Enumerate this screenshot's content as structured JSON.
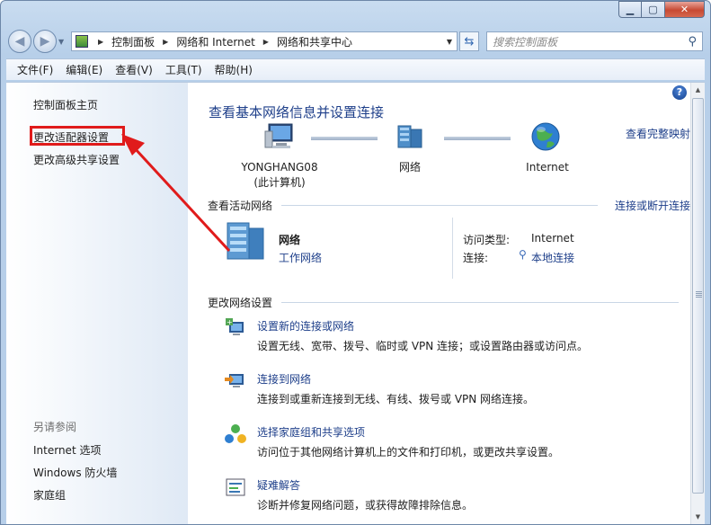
{
  "window": {
    "min_icon": "minimize-icon",
    "max_icon": "maximize-icon",
    "close_icon": "close-icon"
  },
  "address": {
    "breadcrumbs": [
      "控制面板",
      "网络和 Internet",
      "网络和共享中心"
    ],
    "search_placeholder": "搜索控制面板"
  },
  "menu": [
    "文件(F)",
    "编辑(E)",
    "查看(V)",
    "工具(T)",
    "帮助(H)"
  ],
  "sidebar": {
    "home": "控制面板主页",
    "adapter": "更改适配器设置",
    "advanced": "更改高级共享设置",
    "see_also": "另请参阅",
    "links": [
      "Internet 选项",
      "Windows 防火墙",
      "家庭组"
    ]
  },
  "main": {
    "title": "查看基本网络信息并设置连接",
    "full_map": "查看完整映射",
    "computer_name": "YONGHANG08",
    "computer_sub": "(此计算机)",
    "network_label": "网络",
    "internet_label": "Internet",
    "active_title": "查看活动网络",
    "connect_link": "连接或断开连接",
    "active_name": "网络",
    "active_type": "工作网络",
    "access_label": "访问类型:",
    "access_value": "Internet",
    "conn_label": "连接:",
    "conn_value": "本地连接",
    "change_title": "更改网络设置",
    "tasks": [
      {
        "title": "设置新的连接或网络",
        "desc": "设置无线、宽带、拨号、临时或 VPN 连接；或设置路由器或访问点。"
      },
      {
        "title": "连接到网络",
        "desc": "连接到或重新连接到无线、有线、拨号或 VPN 网络连接。"
      },
      {
        "title": "选择家庭组和共享选项",
        "desc": "访问位于其他网络计算机上的文件和打印机，或更改共享设置。"
      },
      {
        "title": "疑难解答",
        "desc": "诊断并修复网络问题，或获得故障排除信息。"
      }
    ]
  },
  "colors": {
    "link": "#1e3f8a",
    "highlight": "#e01b1b"
  }
}
